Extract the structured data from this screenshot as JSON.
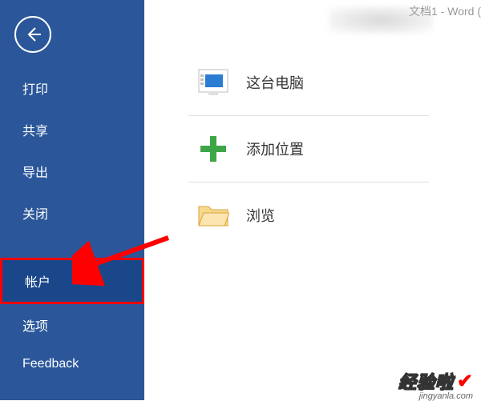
{
  "titlebar": {
    "text": "文档1 - Word ("
  },
  "sidebar": {
    "items": [
      {
        "label": "打印"
      },
      {
        "label": "共享"
      },
      {
        "label": "导出"
      },
      {
        "label": "关闭"
      },
      {
        "label": "帐户"
      },
      {
        "label": "选项"
      },
      {
        "label": "Feedback"
      }
    ]
  },
  "locations": {
    "items": [
      {
        "label": "这台电脑"
      },
      {
        "label": "添加位置"
      },
      {
        "label": "浏览"
      }
    ]
  },
  "watermark": {
    "brand": "经验啦",
    "url": "jingyanla.com"
  }
}
